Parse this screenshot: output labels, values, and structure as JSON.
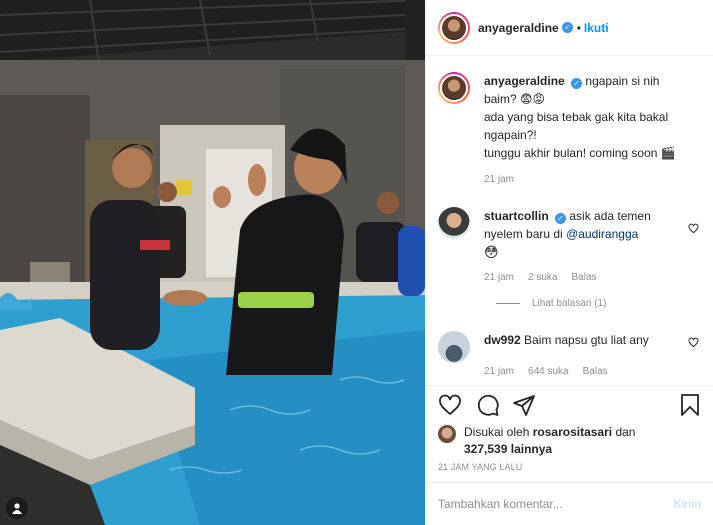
{
  "post": {
    "author": "anyageraldine",
    "follow_label": "Ikuti",
    "dot": "•"
  },
  "caption": {
    "username": "anyageraldine",
    "lines": [
      "ngapain si nih",
      "baim? 😨😡",
      "ada yang bisa tebak gak kita bakal",
      "ngapain?!",
      "tunggu akhir bulan! coming soon 🎬"
    ],
    "time": "21 jam"
  },
  "comments": [
    {
      "username": "stuartcollin",
      "text_before": "asik ada temen",
      "text_line2": "nyelem baru di",
      "mention": "@audirangga",
      "time": "21 jam",
      "likes": "2 suka",
      "reply": "Balas"
    },
    {
      "username": "dw992",
      "text": "Baim napsu gtu liat any",
      "time": "21 jam",
      "likes": "644 suka",
      "reply": "Balas"
    }
  ],
  "view_replies": "Lihat balasan (1)",
  "likes": {
    "prefix": "Disukai oleh",
    "liker": "rosarositasari",
    "mid": "dan",
    "count": "327,539",
    "suffix": "lainnya"
  },
  "time_ago": "21 JAM YANG LALU",
  "comment_box": {
    "placeholder": "Tambahkan komentar...",
    "post_label": "Kirim"
  },
  "icons": {
    "like": "heart-icon",
    "comment": "comment-icon",
    "share": "share-icon",
    "save": "bookmark-icon",
    "verified": "verified-badge-icon"
  },
  "colors": {
    "accent": "#0095f6",
    "verified": "#3897f0",
    "muted": "#8e8e8e"
  }
}
